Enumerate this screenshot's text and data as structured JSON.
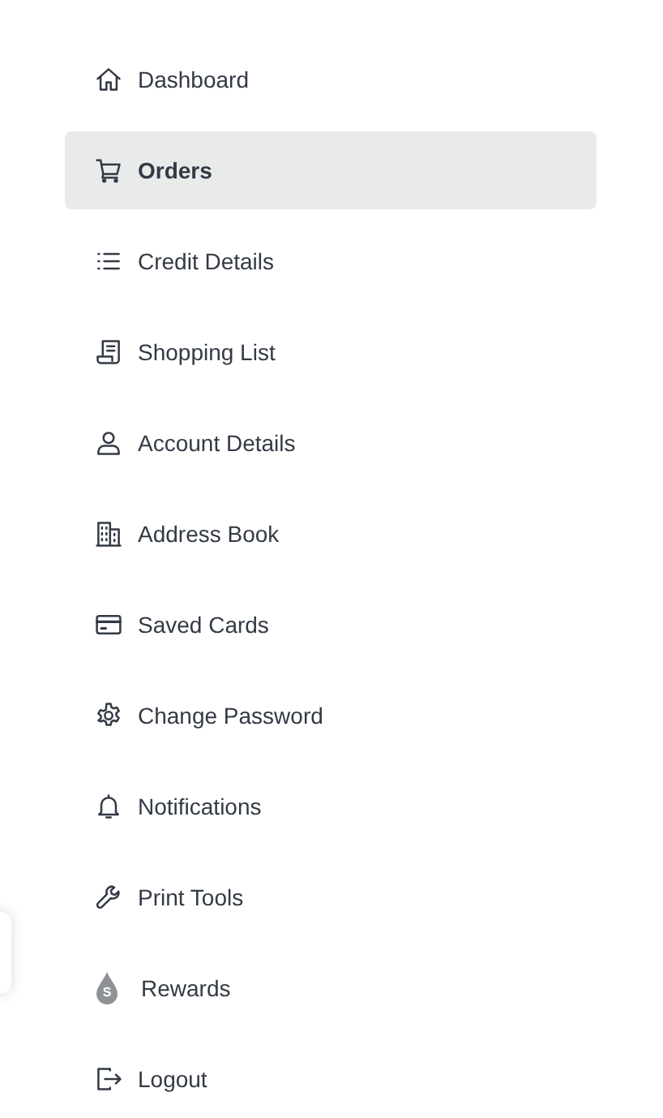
{
  "menu": [
    {
      "kind": "home",
      "label": "Dashboard",
      "selected": false
    },
    {
      "kind": "cart",
      "label": "Orders",
      "selected": true
    },
    {
      "kind": "list",
      "label": "Credit Details",
      "selected": false
    },
    {
      "kind": "receipt",
      "label": "Shopping List",
      "selected": false
    },
    {
      "kind": "user",
      "label": "Account Details",
      "selected": false
    },
    {
      "kind": "building",
      "label": "Address Book",
      "selected": false
    },
    {
      "kind": "card",
      "label": "Saved Cards",
      "selected": false
    },
    {
      "kind": "gear",
      "label": "Change Password",
      "selected": false
    },
    {
      "kind": "bell",
      "label": "Notifications",
      "selected": false
    },
    {
      "kind": "wrench",
      "label": "Print Tools",
      "selected": false
    },
    {
      "kind": "drop",
      "label": "Rewards",
      "selected": false,
      "icon_letter": "S"
    },
    {
      "kind": "logout",
      "label": "Logout",
      "selected": false
    }
  ]
}
